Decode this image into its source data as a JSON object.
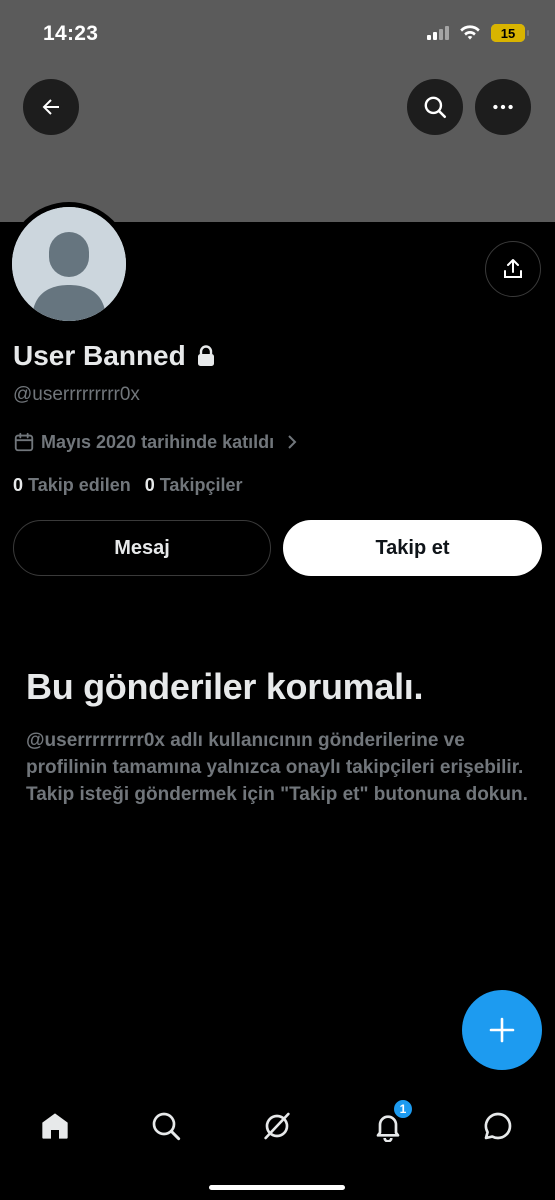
{
  "status_bar": {
    "time": "14:23",
    "battery_level": "15",
    "battery_color": "#d9b400"
  },
  "header": {
    "back_icon": "arrow-left-icon",
    "search_icon": "search-icon",
    "more_icon": "more-horizontal-icon",
    "banner_color": "#5b5b5b"
  },
  "profile": {
    "display_name": "User Banned",
    "handle": "@userrrrrrrrr0x",
    "joined": "Mayıs 2020 tarihinde katıldı",
    "following_count": "0",
    "following_label": "Takip edilen",
    "followers_count": "0",
    "followers_label": "Takipçiler",
    "locked_icon": "lock-icon"
  },
  "actions": {
    "message_label": "Mesaj",
    "follow_label": "Takip et"
  },
  "protected": {
    "title": "Bu gönderiler korumalı.",
    "description": "@userrrrrrrrr0x adlı kullanıcının gönderilerine ve profilinin tamamına yalnızca onaylı takipçileri erişebilir. Takip isteği göndermek için \"Takip et\" butonuna dokun."
  },
  "tab_bar": {
    "notification_badge": "1",
    "accent_color": "#1d9bf0"
  }
}
